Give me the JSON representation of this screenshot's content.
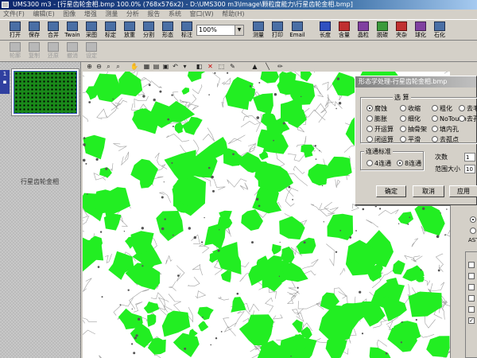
{
  "window": {
    "title": "UMS300 m3 - [行星齿轮金相.bmp 100.0% (768x576x2) - D:\\UMS300 m3\\Image\\颗粒度能力\\行星齿轮金相.bmp]"
  },
  "menu": [
    "文件(F)",
    "编辑(E)",
    "图像",
    "增强",
    "测量",
    "分析",
    "报告",
    "系统",
    "窗口(W)",
    "帮助(H)"
  ],
  "toolbar": {
    "buttons": [
      {
        "label": "打开",
        "icon": "open-folder-icon"
      },
      {
        "label": "保存",
        "icon": "save-disk-icon"
      },
      {
        "label": "合并",
        "icon": "merge-icon"
      },
      {
        "label": "Twain",
        "icon": "twain-scanner-icon"
      },
      {
        "label": "采图",
        "icon": "capture-icon"
      },
      {
        "label": "标定",
        "icon": "calibrate-icon"
      },
      {
        "label": "放重",
        "icon": "zoom-icon"
      },
      {
        "label": "分割",
        "icon": "segment-icon"
      },
      {
        "label": "形态",
        "icon": "morphology-icon"
      },
      {
        "label": "标注",
        "icon": "annotate-icon"
      },
      {
        "label": "测量",
        "icon": "measure-icon"
      },
      {
        "label": "打印",
        "icon": "print-icon"
      },
      {
        "label": "Email",
        "icon": "email-icon"
      },
      {
        "label": "长度",
        "icon": "length-icon"
      },
      {
        "label": "含量",
        "icon": "content-icon"
      },
      {
        "label": "晶粒",
        "icon": "grain-icon"
      },
      {
        "label": "脱碳",
        "icon": "decarburize-icon"
      },
      {
        "label": "夹杂",
        "icon": "inclusion-icon"
      },
      {
        "label": "球化",
        "icon": "spheroid-icon"
      },
      {
        "label": "石化",
        "icon": "graphite-icon"
      }
    ],
    "zoom": "100%"
  },
  "toolbar2": {
    "buttons": [
      {
        "label": "轮廓",
        "icon": "outline-icon"
      },
      {
        "label": "复制",
        "icon": "copy-icon"
      },
      {
        "label": "还原",
        "icon": "restore-icon"
      },
      {
        "label": "撤消",
        "icon": "undo-icon"
      },
      {
        "label": "设定",
        "icon": "settings-icon"
      }
    ]
  },
  "thumbnail": {
    "caption": "行星齿轮金相"
  },
  "dialog": {
    "title": "形态学处理-行星齿轮金相.bmp",
    "group1_label": "选 算",
    "options": [
      {
        "label": "腐蚀",
        "checked": true
      },
      {
        "label": "收缩",
        "checked": false
      },
      {
        "label": "粗化",
        "checked": false
      },
      {
        "label": "去毛刺",
        "checked": false
      },
      {
        "label": "膨胀",
        "checked": false
      },
      {
        "label": "细化",
        "checked": false
      },
      {
        "label": "NoTouch",
        "checked": false
      },
      {
        "label": "去孔",
        "checked": false
      },
      {
        "label": "开运算",
        "checked": false
      },
      {
        "label": "抽骨架",
        "checked": false
      },
      {
        "label": "填内孔",
        "checked": false
      },
      {
        "label": "闭运算",
        "checked": false
      },
      {
        "label": "平滑",
        "checked": false
      },
      {
        "label": "去孤点",
        "checked": false
      }
    ],
    "group2_label": "连通标准",
    "connectivity": [
      {
        "label": "4连通",
        "checked": false
      },
      {
        "label": "8连通",
        "checked": true
      }
    ],
    "count_label": "次数",
    "count_value": "1",
    "range_label": "范围大小",
    "range_value": "10",
    "ok_label": "确定",
    "cancel_label": "取消",
    "apply_label": "应用"
  },
  "side_panel": {
    "text": "AST"
  },
  "colors": {
    "phase": "#22ee22",
    "background": "#ffffff",
    "boundary": "#888888"
  }
}
